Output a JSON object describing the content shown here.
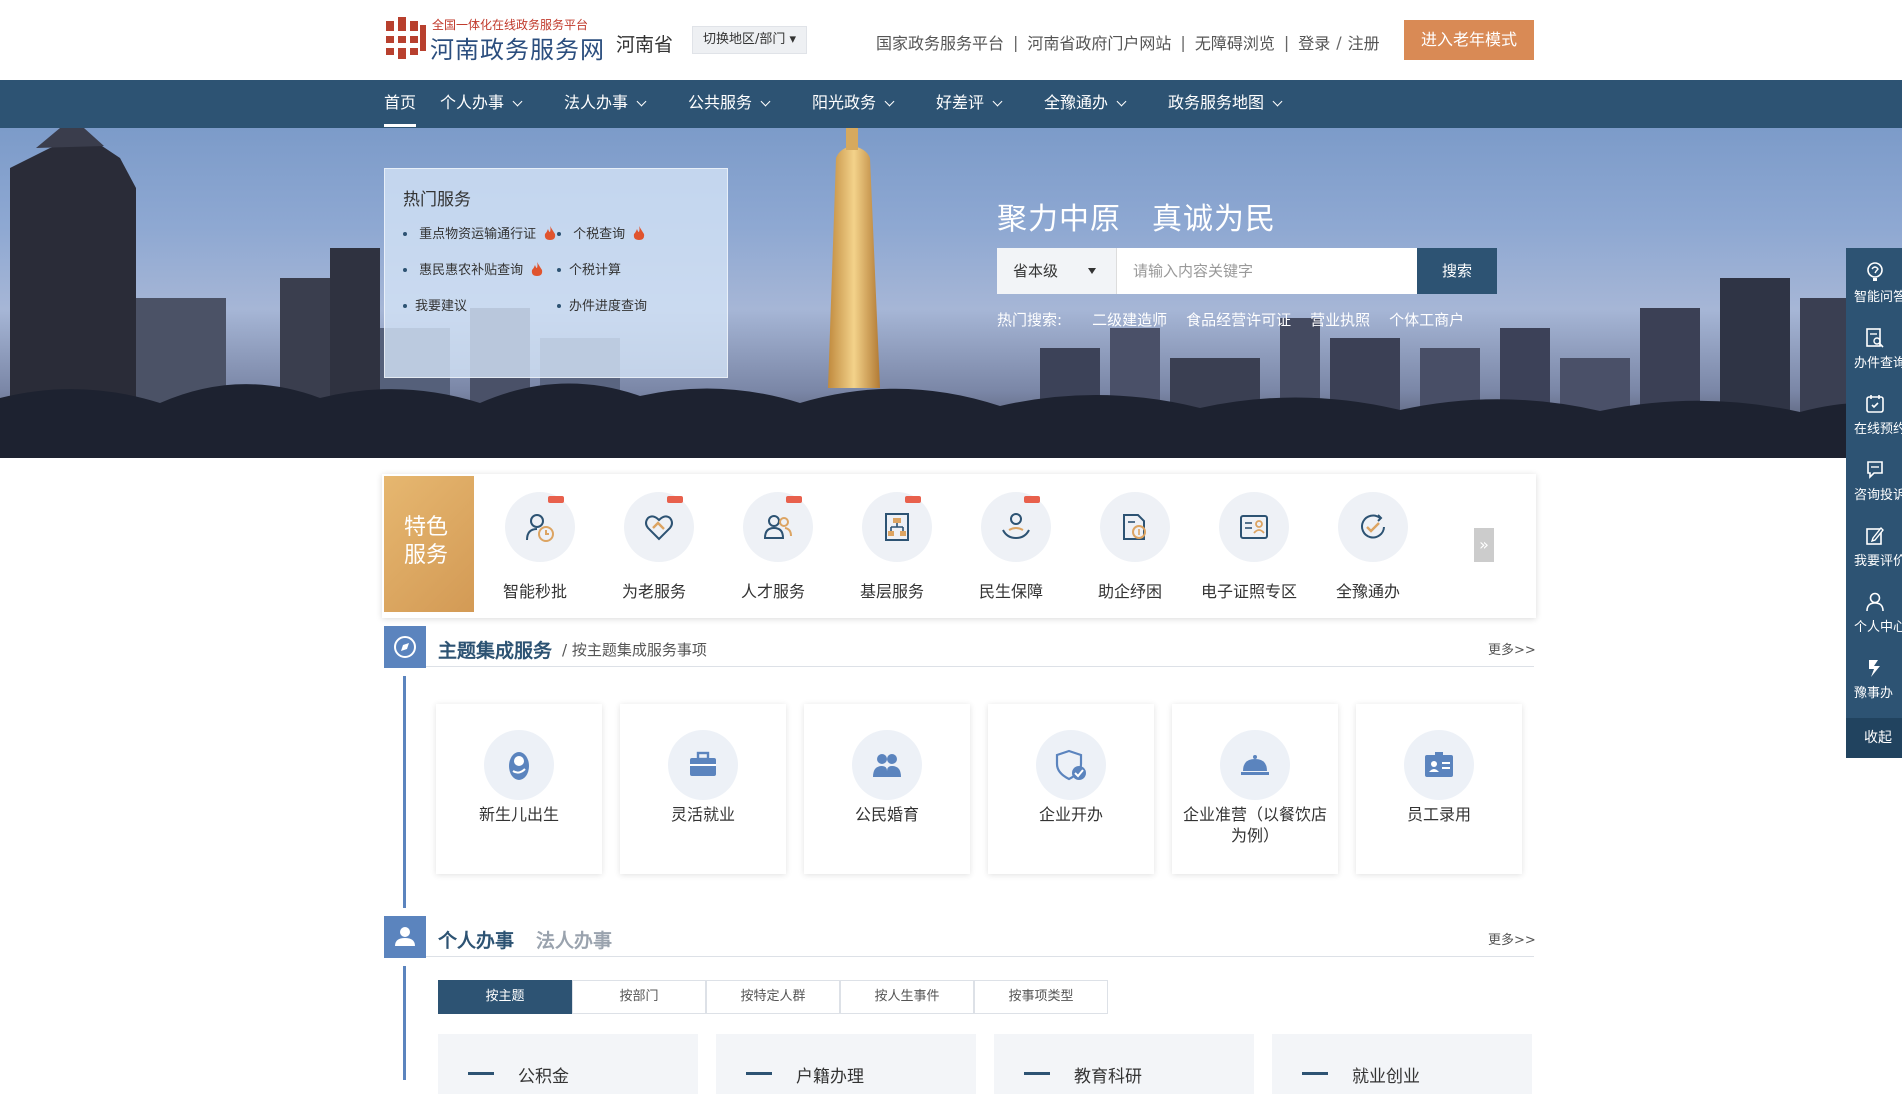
{
  "header": {
    "logo_sub": "全国一体化在线政务服务平台",
    "logo_title": "河南政务服务网",
    "province": "河南省",
    "region_switch": "切换地区/部门 ▾",
    "links": [
      "国家政务服务平台",
      "河南省政府门户网站",
      "无障碍浏览"
    ],
    "login": "登录",
    "register": "注册",
    "elder_mode": "进入老年模式"
  },
  "nav": {
    "items": [
      "首页",
      "个人办事",
      "法人办事",
      "公共服务",
      "阳光政务",
      "好差评",
      "全豫通办",
      "政务服务地图"
    ]
  },
  "banner": {
    "hot_title": "热门服务",
    "hot_items": [
      "重点物资运输通行证",
      "个税查询",
      "惠民惠农补贴查询",
      "个税计算",
      "我要建议",
      "办件进度查询"
    ],
    "slogan": "聚力中原　真诚为民",
    "scope": "省本级",
    "search_placeholder": "请输入内容关键字",
    "search_btn": "搜索",
    "hot_search_label": "热门搜索:",
    "hot_keywords": [
      "二级建造师",
      "食品经营许可证",
      "营业执照",
      "个体工商户"
    ]
  },
  "right_float": {
    "items": [
      "智能问答",
      "办件查询",
      "在线预约",
      "咨询投诉",
      "我要评价",
      "个人中心",
      "豫事办"
    ],
    "collapse": "收起"
  },
  "featured": {
    "label_line1": "特色",
    "label_line2": "服务",
    "items": [
      "智能秒批",
      "为老服务",
      "人才服务",
      "基层服务",
      "民生保障",
      "助企纾困",
      "电子证照专区",
      "全豫通办"
    ],
    "next": "»"
  },
  "theme_section": {
    "title": "主题集成服务",
    "subtitle": "/ 按主题集成服务事项",
    "more": "更多>>",
    "cards": [
      "新生儿出生",
      "灵活就业",
      "公民婚育",
      "企业开办",
      "企业准营（以餐饮店为例）",
      "员工录用"
    ]
  },
  "affairs_section": {
    "title_personal": "个人办事",
    "title_legal": "法人办事",
    "more": "更多>>",
    "tabs": [
      "按主题",
      "按部门",
      "按特定人群",
      "按人生事件",
      "按事项类型"
    ],
    "categories": [
      "公积金",
      "户籍办理",
      "教育科研",
      "就业创业"
    ]
  },
  "colors": {
    "primary": "#2d5373",
    "accent": "#5b84be",
    "elder_btn": "#d98a55",
    "feature_gold": "#dca462"
  }
}
